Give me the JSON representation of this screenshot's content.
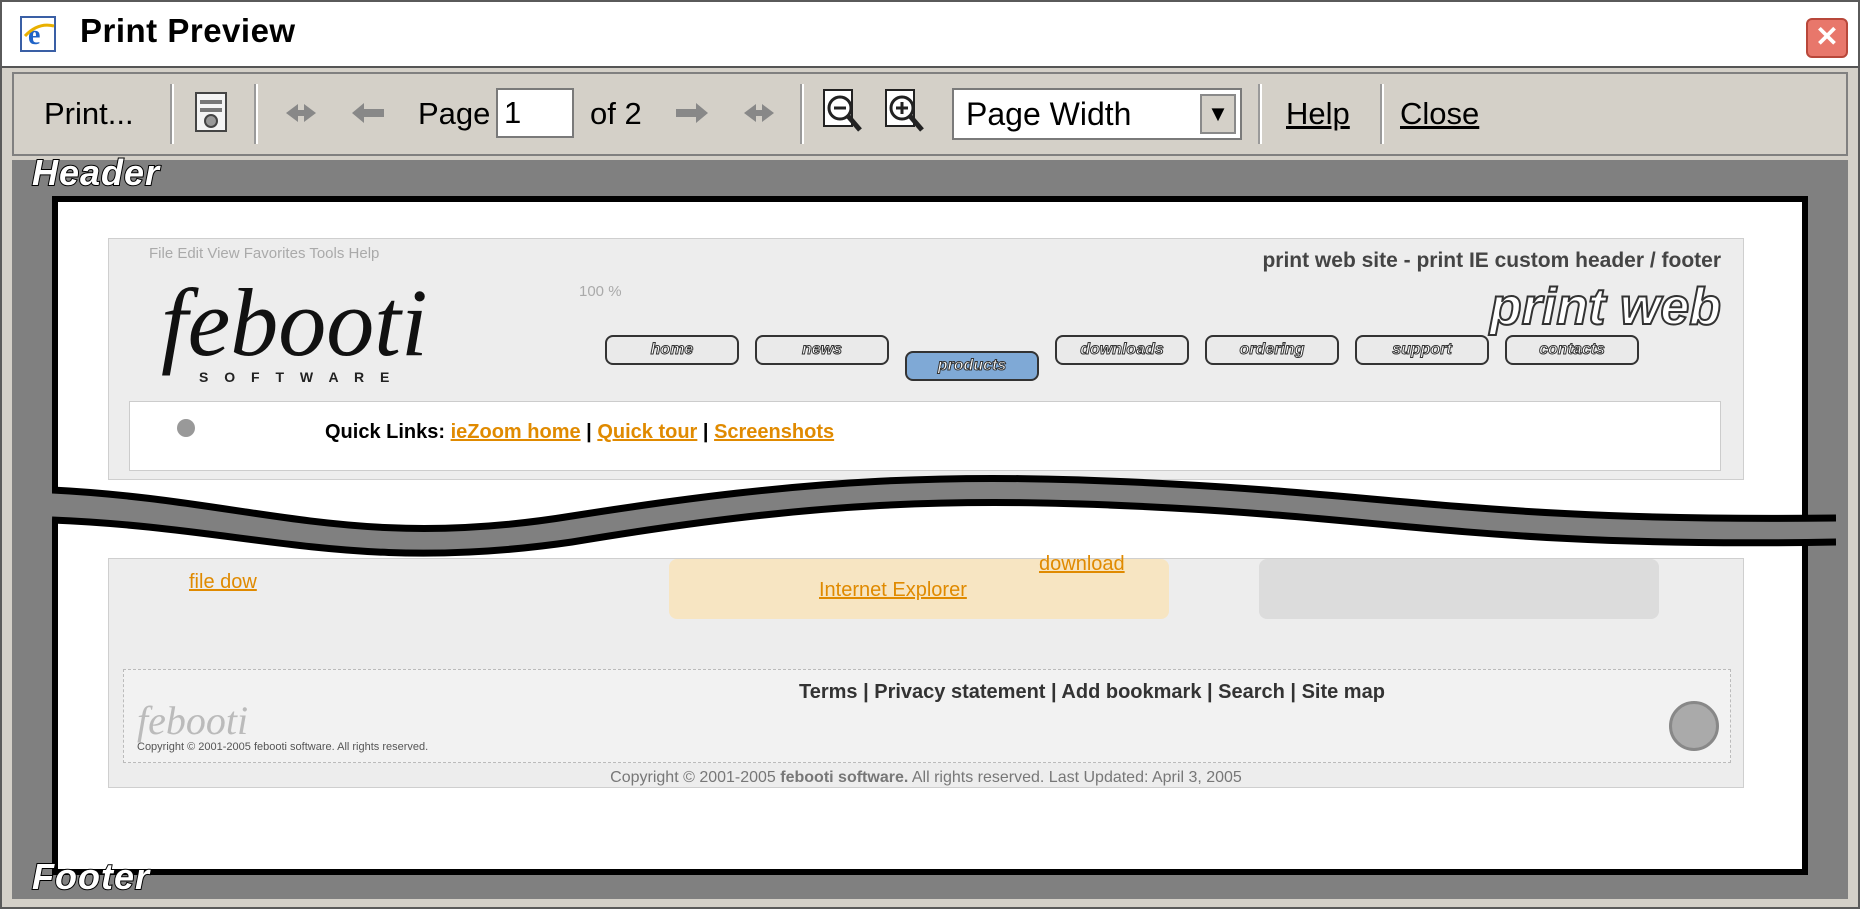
{
  "window": {
    "title": "Print Preview"
  },
  "toolbar": {
    "print_label": "Print...",
    "page_label": "Page",
    "page_value": "1",
    "of_label": "of 2",
    "zoom_value": "Page Width",
    "help_label": "Help",
    "close_label": "Close"
  },
  "preview": {
    "header_label": "Header",
    "footer_label": "Footer",
    "header_text": "print web site - print IE custom header / footer",
    "brand_title": "print web",
    "logo_text": "febooti",
    "logo_sub": "S O F T W A R E",
    "nav_items": [
      "home",
      "news",
      "products",
      "downloads",
      "ordering",
      "support",
      "contacts"
    ],
    "quick_links_label": "Quick Links:",
    "quick_links": [
      "ieZoom home",
      "Quick tour",
      "Screenshots"
    ],
    "fragment_download": "download",
    "fragment_ie": "Internet Explorer",
    "fragment_file": "file dow",
    "footer_links": "Terms | Privacy statement | Add bookmark | Search | Site map",
    "footer_small": "Copyright © 2001-2005 febooti software. All rights reserved.",
    "copyright_prefix": "Copyright © 2001-2005 ",
    "copyright_bold": "febooti software.",
    "copyright_suffix": " All rights reserved. Last Updated: April 3, 2005",
    "menu_hint": "File  Edit  View  Favorites  Tools  Help",
    "zoom_hint": "100 %"
  }
}
